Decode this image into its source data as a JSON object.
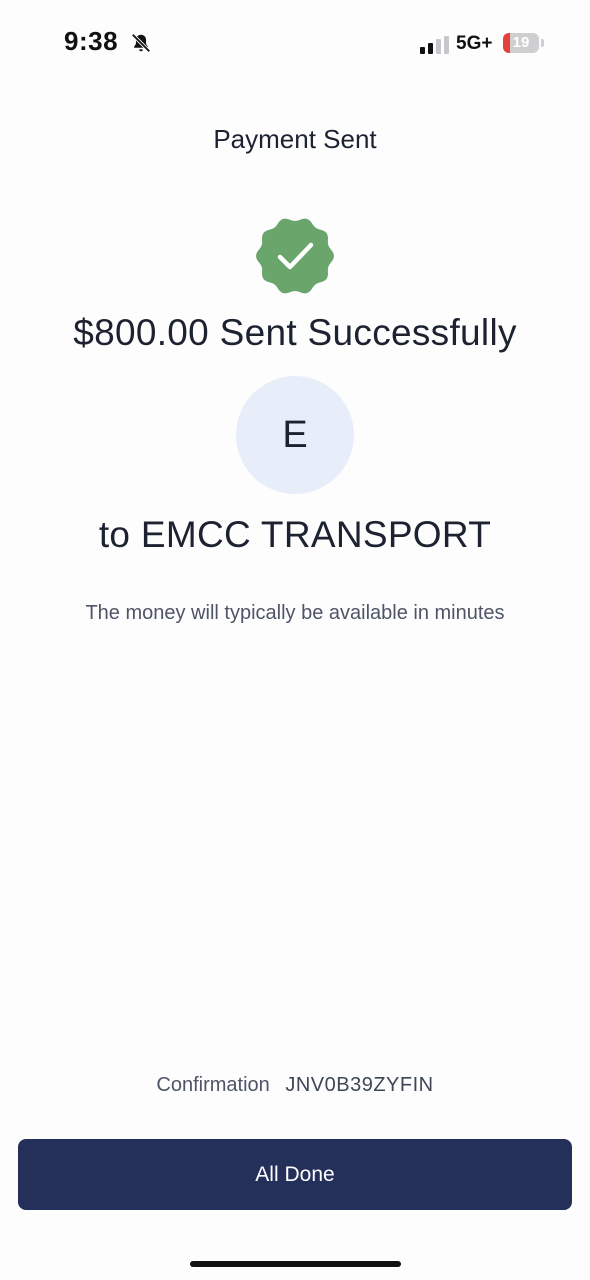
{
  "status_bar": {
    "time": "9:38",
    "network": "5G+",
    "battery_level": "19",
    "battery_fraction": 0.19,
    "signal_bars_active": 2,
    "signal_bars_total": 4
  },
  "header": {
    "title": "Payment Sent"
  },
  "result": {
    "amount_message": "$800.00 Sent Successfully",
    "recipient_initial": "E",
    "recipient_line": "to EMCC TRANSPORT",
    "availability_note": "The money will typically be available in minutes"
  },
  "confirmation": {
    "label": "Confirmation",
    "code": "JNV0B39ZYFIN"
  },
  "actions": {
    "done_label": "All Done"
  },
  "colors": {
    "success_green": "#6aa56b",
    "button_navy": "#242f5a",
    "avatar_bg": "#e8eef9",
    "battery_red": "#e5403a"
  },
  "icons": {
    "bell": "bell-slash-icon",
    "signal": "cellular-signal-icon",
    "success": "checkmark-badge-icon"
  }
}
